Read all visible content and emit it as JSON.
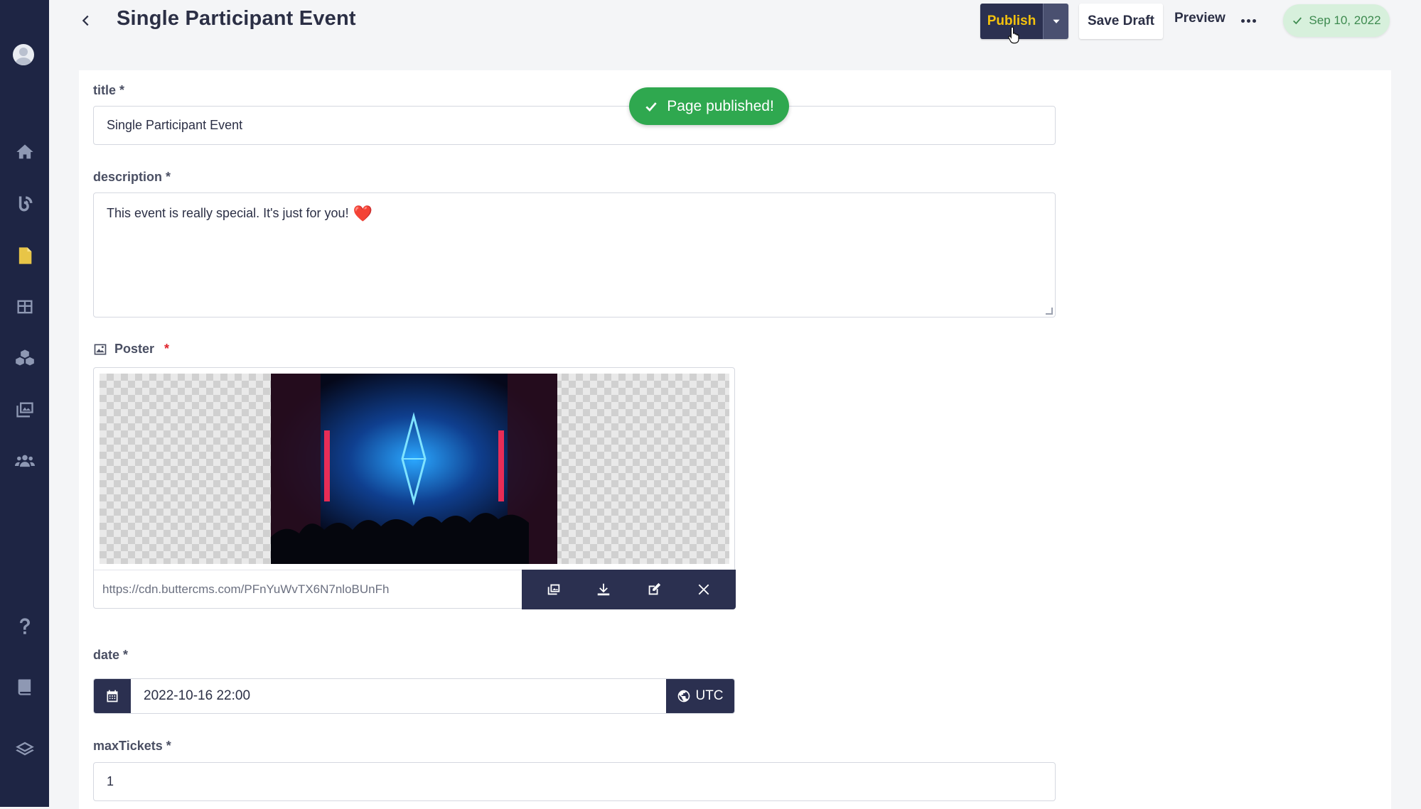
{
  "sidebar": {
    "items": [
      {
        "name": "avatar"
      },
      {
        "name": "home-icon"
      },
      {
        "name": "blog-icon"
      },
      {
        "name": "pages-icon"
      },
      {
        "name": "collections-icon"
      },
      {
        "name": "components-icon"
      },
      {
        "name": "media-icon"
      },
      {
        "name": "users-icon"
      },
      {
        "name": "help-icon"
      },
      {
        "name": "docs-icon"
      },
      {
        "name": "layers-icon"
      }
    ]
  },
  "header": {
    "title": "Single Participant Event",
    "publish_label": "Publish",
    "save_draft_label": "Save Draft",
    "preview_label": "Preview",
    "status_date": "Sep 10, 2022"
  },
  "toast": {
    "message": "Page published!"
  },
  "fields": {
    "title": {
      "label": "title *",
      "value": "Single Participant Event"
    },
    "description": {
      "label": "description *",
      "value": "This event is really special. It's just for you!",
      "emoji": "❤️"
    },
    "poster": {
      "label": "Poster",
      "required_mark": "*",
      "url": "https://cdn.buttercms.com/PFnYuWvTX6N7nloBUnFh"
    },
    "date": {
      "label": "date *",
      "value": "2022-10-16 22:00",
      "timezone": "UTC"
    },
    "maxTickets": {
      "label": "maxTickets *",
      "value": "1"
    }
  },
  "colors": {
    "sidebar": "#1e2544",
    "primary_dark": "#2b3050",
    "publish_text": "#f4c20d",
    "success": "#2fa84f"
  }
}
